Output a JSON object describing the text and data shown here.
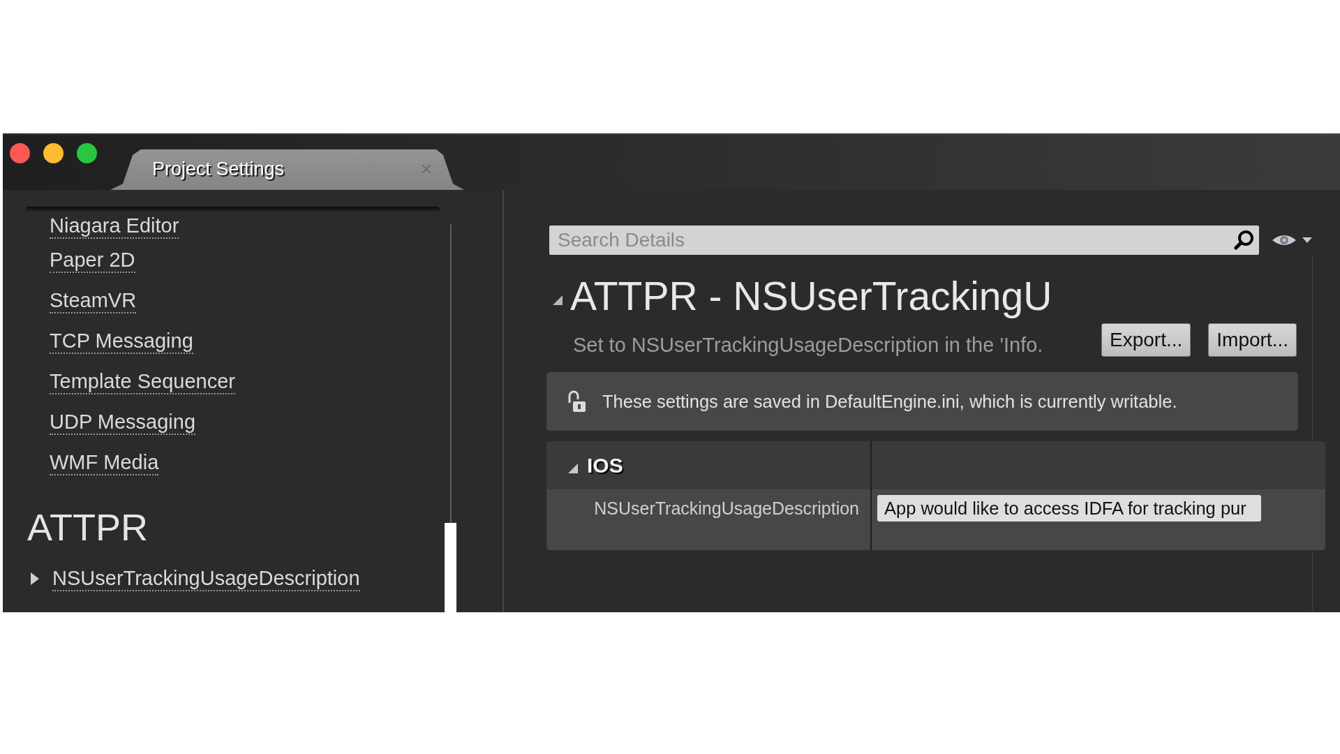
{
  "tabs": [
    {
      "label": "Project Settings",
      "selected": true
    }
  ],
  "sidebar": {
    "groups": [
      {
        "items": [
          {
            "label": "Niagara Editor"
          },
          {
            "label": "Paper 2D"
          },
          {
            "label": "SteamVR"
          },
          {
            "label": "TCP Messaging"
          },
          {
            "label": "Template Sequencer"
          },
          {
            "label": "UDP Messaging"
          },
          {
            "label": "WMF Media"
          }
        ]
      },
      {
        "title": "ATTPR",
        "items": [
          {
            "label": "NSUserTrackingUsageDescription",
            "expanded": false
          }
        ]
      }
    ]
  },
  "details": {
    "search": {
      "placeholder": "Search Details"
    },
    "section": {
      "title": "ATTPR - NSUserTrackingU",
      "expanded": true,
      "description": "Set to NSUserTrackingUsageDescription in the 'Info.",
      "buttons": [
        "Export...",
        "Import..."
      ]
    },
    "notice": "These settings are saved in DefaultEngine.ini, which is currently writable.",
    "categories": [
      {
        "title": "IOS",
        "expanded": true,
        "properties": [
          {
            "name": "NSUserTrackingUsageDescription",
            "value": "App would like to access IDFA for tracking pur"
          }
        ]
      }
    ]
  }
}
